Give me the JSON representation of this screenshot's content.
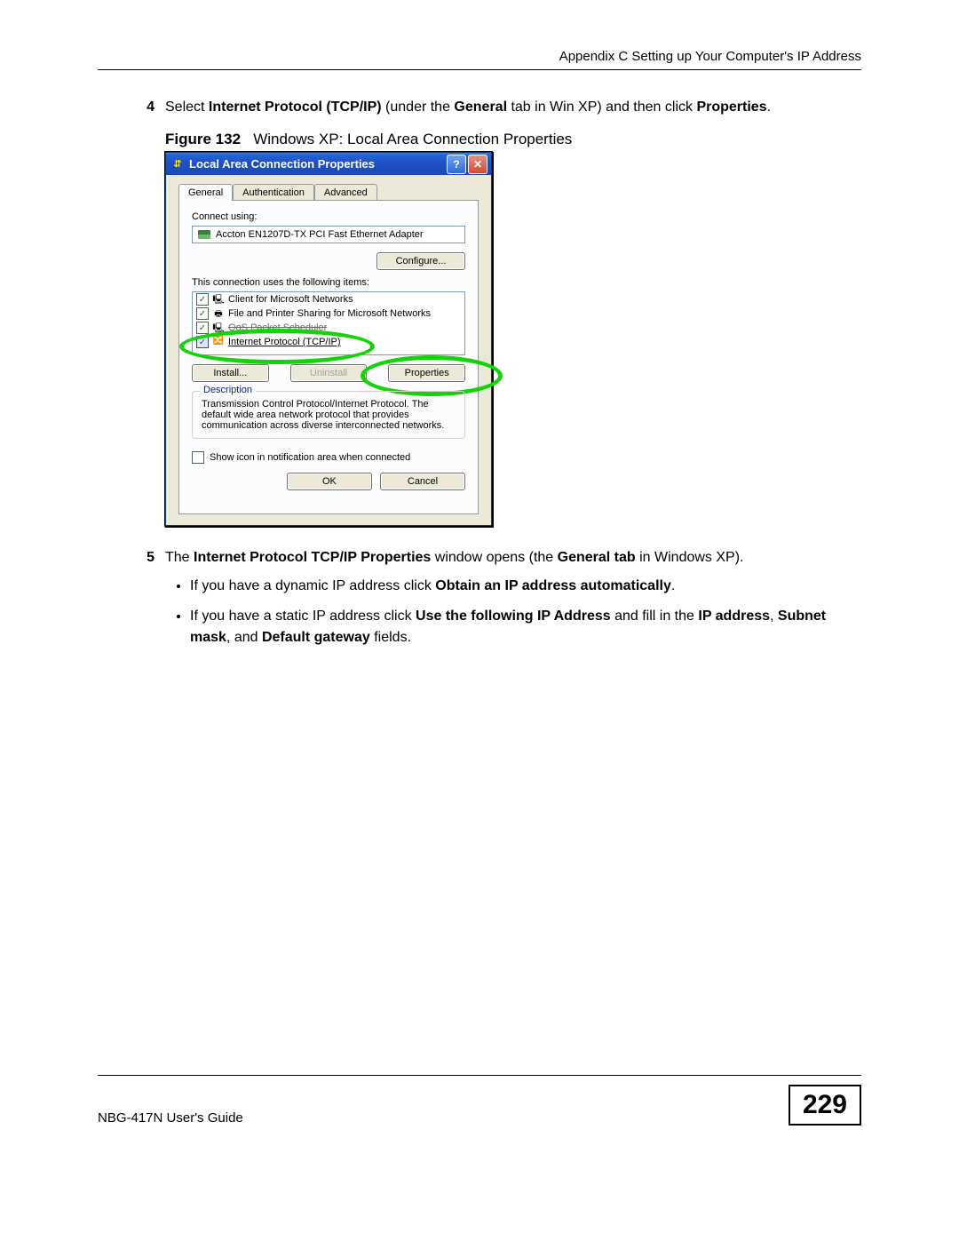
{
  "header": "Appendix C Setting up Your Computer's IP Address",
  "steps": {
    "4": {
      "num": "4",
      "text_pre": "Select ",
      "b1": "Internet Protocol (TCP/IP)",
      "text_mid": " (under the ",
      "b2": "General",
      "text_mid2": " tab in Win XP) and then click ",
      "b3": "Properties",
      "text_end": "."
    },
    "5": {
      "num": "5",
      "pre": "The ",
      "b1": "Internet Protocol TCP/IP Properties",
      "mid1": " window opens (the ",
      "b2": "General tab",
      "mid2": " in Windows XP).",
      "bullets": [
        {
          "pre": "If you have a dynamic IP address click ",
          "b1": "Obtain an IP address automatically",
          "post": "."
        },
        {
          "pre": "If you have a static IP address click ",
          "b1": "Use the following IP Address",
          "mid": " and fill in the ",
          "b2": "IP address",
          "sep1": ", ",
          "b3": "Subnet mask",
          "sep2": ", and ",
          "b4": "Default gateway",
          "post": " fields."
        }
      ]
    }
  },
  "figure": {
    "label": "Figure 132",
    "caption": "Windows XP: Local Area Connection Properties"
  },
  "dialog": {
    "title": "Local Area Connection Properties",
    "tabs": [
      "General",
      "Authentication",
      "Advanced"
    ],
    "connect_label": "Connect using:",
    "adapter": "Accton EN1207D-TX PCI Fast Ethernet Adapter",
    "configure_btn": "Configure...",
    "uses_label": "This connection uses the following items:",
    "items": [
      "Client for Microsoft Networks",
      "File and Printer Sharing for Microsoft Networks",
      "QoS Packet Scheduler",
      "Internet Protocol (TCP/IP)"
    ],
    "install_btn": "Install...",
    "uninstall_btn": "Uninstall",
    "properties_btn": "Properties",
    "desc_legend": "Description",
    "desc_text": "Transmission Control Protocol/Internet Protocol. The default wide area network protocol that provides communication across diverse interconnected networks.",
    "show_icon": "Show icon in notification area when connected",
    "ok": "OK",
    "cancel": "Cancel"
  },
  "footer": {
    "guide": "NBG-417N User's Guide",
    "page": "229"
  }
}
